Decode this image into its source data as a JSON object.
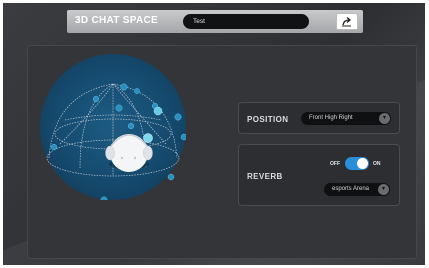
{
  "header": {
    "title": "3D CHAT SPACE",
    "name_value": "Test"
  },
  "position": {
    "label": "POSITION",
    "selected": "Front High Right"
  },
  "reverb": {
    "label": "REVERB",
    "toggle_off_label": "OFF",
    "toggle_on_label": "ON",
    "toggle_state": "on",
    "selected": "esports Arena"
  },
  "colors": {
    "accent": "#2a8fd8",
    "sphere_node": "#2a8fbf",
    "globe": "#154a6e"
  }
}
